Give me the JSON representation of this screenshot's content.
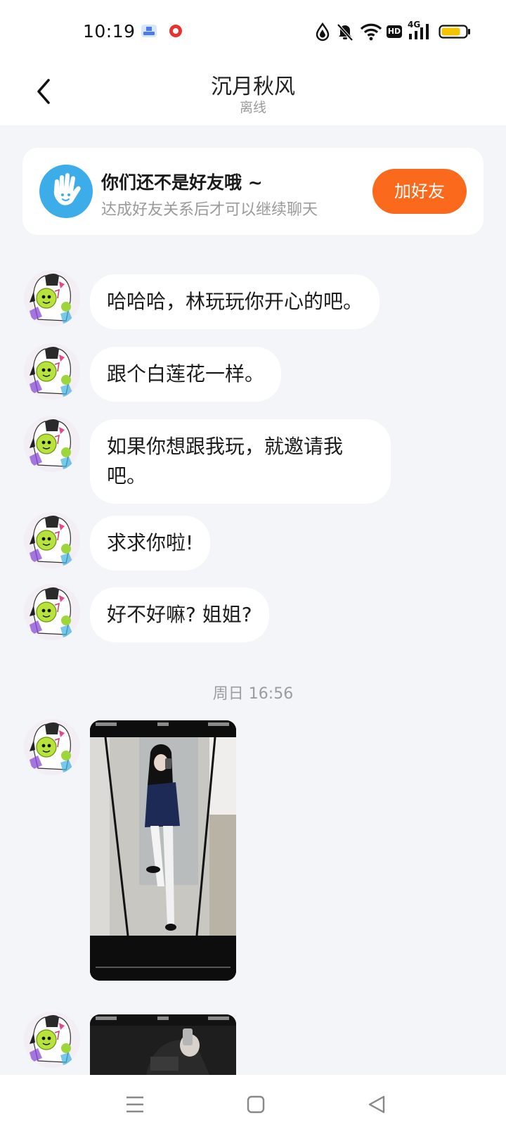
{
  "status_bar": {
    "time": "10:19",
    "left_icons": [
      "ships-app-icon",
      "red-record-icon"
    ],
    "network": "4G",
    "hd_badge": "HD",
    "battery_color": "#f5c400"
  },
  "header": {
    "title": "沉月秋风",
    "status": "离线"
  },
  "friend_card": {
    "title": "你们还不是好友哦 ~",
    "subtitle": "达成好友关系后才可以继续聊天",
    "button_label": "加好友",
    "accent": "#fb6a1c",
    "icon_color": "#3dade9"
  },
  "messages": [
    {
      "text": "哈哈哈，林玩玩你开心的吧。"
    },
    {
      "text": "跟个白莲花一样。"
    },
    {
      "text": "如果你想跟我玩，就邀请我吧。"
    },
    {
      "text": "求求你啦!"
    },
    {
      "text": "好不好嘛? 姐姐?"
    }
  ],
  "timestamp": "周日 16:56",
  "photo_messages": [
    {
      "type": "image",
      "description_icon": "photo-screenshot"
    },
    {
      "type": "image",
      "description_icon": "photo-screenshot"
    }
  ],
  "nav_bar": {
    "buttons": [
      "menu-icon",
      "home-icon",
      "back-triangle-icon"
    ]
  }
}
